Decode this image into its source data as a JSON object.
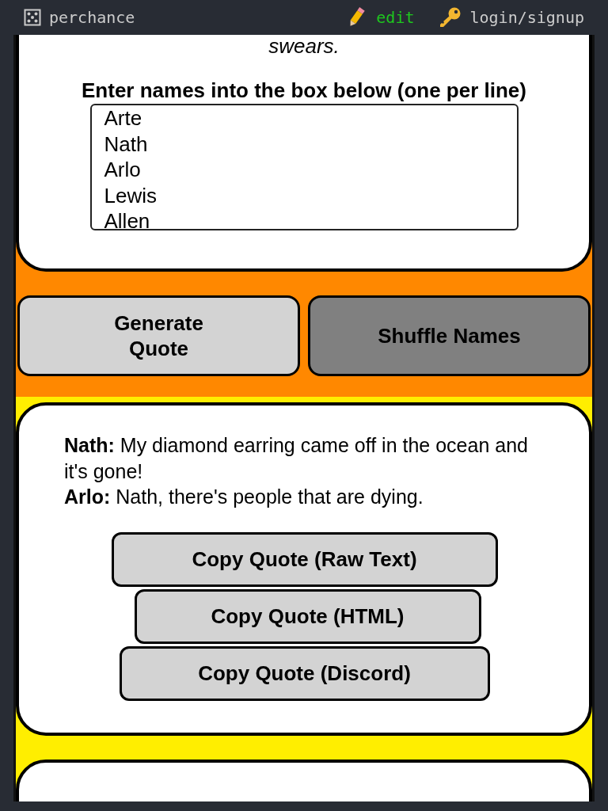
{
  "topbar": {
    "site": "perchance",
    "edit": "edit",
    "login": "login/signup"
  },
  "intro": {
    "tail": "swears.",
    "heading": "Enter names into the box below (one per line)",
    "names": [
      "Arte",
      "Nath",
      "Arlo",
      "Lewis",
      "Allen"
    ]
  },
  "actions": [
    {
      "label": "Generate Quote",
      "selected": false
    },
    {
      "label": "Shuffle Names",
      "selected": true
    }
  ],
  "quote": {
    "lines": [
      "**Nath:** My diamond earring came off in the ocean and it's gone!",
      "**Arlo:** Nath, there's people that are dying."
    ],
    "copy_buttons": [
      "Copy Quote (Raw Text)",
      "Copy Quote (HTML)",
      "Copy Quote (Discord)"
    ]
  }
}
